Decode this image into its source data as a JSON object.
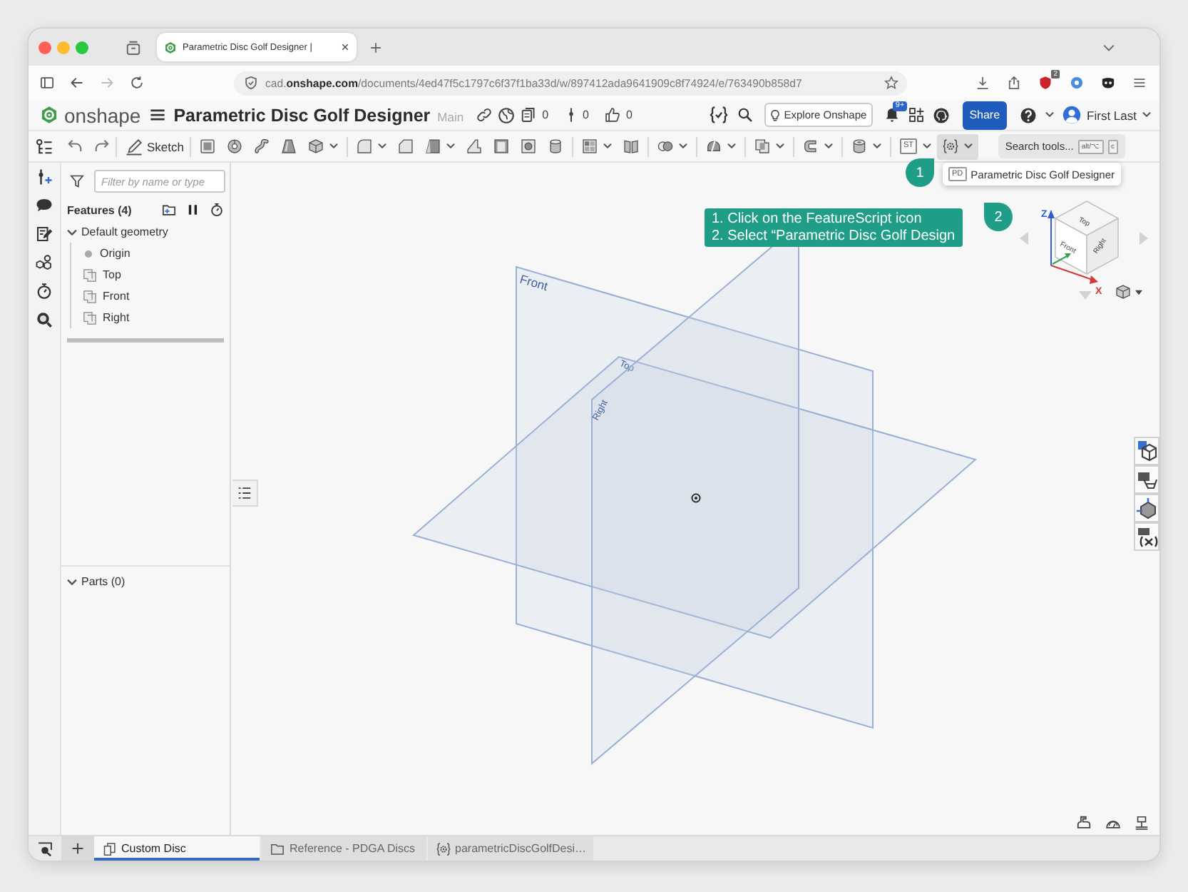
{
  "browser": {
    "tab": {
      "title": "Parametric Disc Golf Designer |"
    },
    "nav": [
      {
        "kind": "sidebar",
        "disabled": false
      },
      {
        "kind": "back",
        "disabled": false
      },
      {
        "kind": "forward",
        "disabled": true
      },
      {
        "kind": "reload",
        "disabled": false
      }
    ],
    "url": "cad.**onshape.com**/documents/4ed47f5c1797c6f37f1ba33d/w/897412ada9641909c8f74924/e/763490b858d7",
    "extension_badge": "2"
  },
  "app_header": {
    "logo_text": "onshape",
    "document_title": "Parametric Disc Golf Designer",
    "workspace": "Main",
    "counters": [
      {
        "kind": "copies",
        "value": "0"
      },
      {
        "kind": "branches",
        "value": "0"
      },
      {
        "kind": "likes",
        "value": "0"
      }
    ],
    "explore_button": "Explore Onshape",
    "notification_badge": "9+",
    "share_button": "Share",
    "user_name": "First Last"
  },
  "toolbar": {
    "sketch_button": "Sketch",
    "tool_groups": [
      {
        "tools": [
          {
            "kind": "extrude",
            "menu": false,
            "selected": false
          },
          {
            "kind": "revolve",
            "menu": false,
            "selected": false
          },
          {
            "kind": "sweep",
            "menu": false,
            "selected": false
          },
          {
            "kind": "loft",
            "menu": false,
            "selected": false
          },
          {
            "kind": "thicken",
            "menu": true,
            "selected": false
          }
        ]
      },
      {
        "tools": [
          {
            "kind": "fillet",
            "menu": true,
            "selected": false
          },
          {
            "kind": "chamfer",
            "menu": false,
            "selected": false
          },
          {
            "kind": "draft",
            "menu": true,
            "selected": false
          },
          {
            "kind": "rib",
            "menu": false,
            "selected": false
          },
          {
            "kind": "shell",
            "menu": false,
            "selected": false
          },
          {
            "kind": "hole",
            "menu": false,
            "selected": false
          },
          {
            "kind": "cylinder",
            "menu": false,
            "selected": false
          }
        ]
      },
      {
        "tools": [
          {
            "kind": "pattern",
            "menu": true,
            "selected": false
          },
          {
            "kind": "mirror",
            "menu": false,
            "selected": false
          }
        ]
      },
      {
        "tools": [
          {
            "kind": "boolean",
            "menu": true,
            "selected": false
          }
        ]
      },
      {
        "tools": [
          {
            "kind": "split",
            "menu": true,
            "selected": false
          }
        ]
      },
      {
        "tools": [
          {
            "kind": "plane",
            "menu": true,
            "selected": false
          }
        ]
      },
      {
        "tools": [
          {
            "kind": "bracket",
            "menu": true,
            "selected": false
          }
        ]
      },
      {
        "tools": [
          {
            "kind": "tube",
            "menu": true,
            "selected": false
          }
        ]
      },
      {
        "tools": [
          {
            "kind": "text",
            "label": "ST",
            "menu": true,
            "selected": false
          },
          {
            "kind": "featurescript",
            "menu": true,
            "selected": true
          }
        ]
      }
    ],
    "search": {
      "label": "Search tools...",
      "keys": [
        "alt/⌥",
        "c"
      ]
    }
  },
  "feature_panel": {
    "filter_placeholder": "Filter by name or type",
    "features_heading": "Features (4)",
    "tree": [
      {
        "label": "Default geometry",
        "expanded": true,
        "children": [
          {
            "label": "Origin",
            "kind": "point"
          },
          {
            "label": "Top",
            "kind": "plane"
          },
          {
            "label": "Front",
            "kind": "plane"
          },
          {
            "label": "Right",
            "kind": "plane"
          }
        ]
      }
    ],
    "parts": {
      "heading": "Parts (0)",
      "expanded": true
    }
  },
  "viewport": {
    "planes": [
      {
        "kind": "front",
        "label": "Front"
      },
      {
        "kind": "top",
        "label": "Top"
      },
      {
        "kind": "right",
        "label": "Right"
      }
    ],
    "callout": {
      "lines": [
        "1. Click on the FeatureScript icon",
        "2. Select “Parametric Disc Golf Design"
      ]
    },
    "step_markers": [
      {
        "kind": "toolbar",
        "label": "1"
      },
      {
        "kind": "menu",
        "label": "2"
      }
    ],
    "dropdown_menu": {
      "items": [
        {
          "icon_text": "PD",
          "label": "Parametric Disc Golf Designer"
        }
      ]
    },
    "view_cube": {
      "faces": [
        {
          "kind": "top",
          "label": "Top"
        },
        {
          "kind": "front",
          "label": "Front"
        },
        {
          "kind": "right",
          "label": "Right"
        }
      ],
      "axes": [
        {
          "kind": "z",
          "label": "Z"
        },
        {
          "kind": "x",
          "label": "X"
        }
      ]
    }
  },
  "bottom_tabs": [
    {
      "kind": "part_studio",
      "label": "Custom Disc",
      "selected": true
    },
    {
      "kind": "folder",
      "label": "Reference - PDGA Discs",
      "selected": false
    },
    {
      "kind": "featurescript",
      "label": "parametricDiscGolfDesi…",
      "selected": false
    }
  ]
}
